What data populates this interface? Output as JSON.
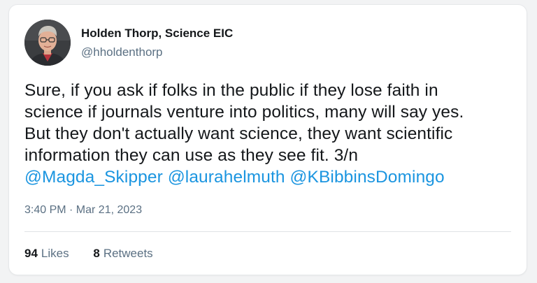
{
  "author": {
    "name": "Holden Thorp, Science EIC",
    "handle": "@hholdenthorp"
  },
  "tweet": {
    "lines": [
      "Sure, if you ask if folks in the public if they lose faith in",
      "science if journals venture into politics, many will say yes.",
      "But they don't actually want science, they want scientific",
      "information they can use as they see fit. 3/n"
    ],
    "mentions": [
      "@Magda_Skipper",
      "@laurahelmuth",
      "@KBibbinsDomingo"
    ],
    "timestamp": "3:40 PM · Mar 21, 2023"
  },
  "stats": {
    "likes_count": "94",
    "likes_label": "Likes",
    "retweets_count": "8",
    "retweets_label": "Retweets"
  },
  "colors": {
    "link": "#1b95e0",
    "text": "#14171a",
    "muted": "#5b7083"
  },
  "icons": {
    "avatar": "profile-photo"
  }
}
